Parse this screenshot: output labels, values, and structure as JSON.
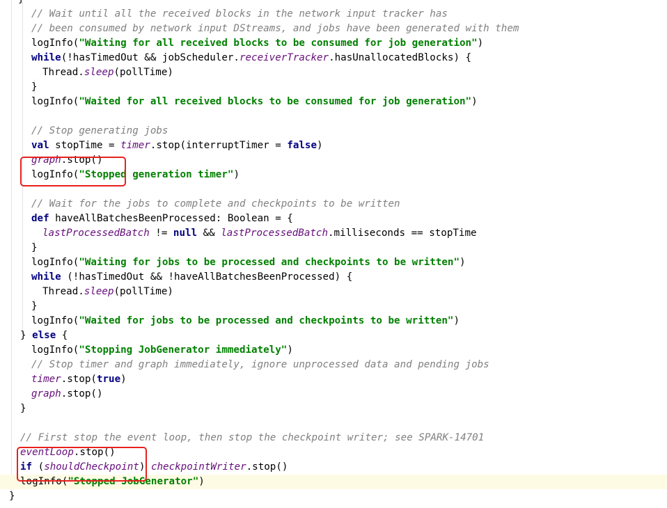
{
  "lines": [
    {
      "tokens": [
        {
          "t": "}",
          "c": "plain"
        }
      ]
    },
    {
      "tokens": [
        {
          "t": "// Wait until all the received blocks in the network input tracker has",
          "c": "comment"
        }
      ]
    },
    {
      "tokens": [
        {
          "t": "// been consumed by network input DStreams, and jobs have been generated with them",
          "c": "comment"
        }
      ]
    },
    {
      "tokens": [
        {
          "t": "logInfo(",
          "c": "plain"
        },
        {
          "t": "\"Waiting for all received blocks to be consumed for job generation\"",
          "c": "string"
        },
        {
          "t": ")",
          "c": "plain"
        }
      ]
    },
    {
      "tokens": [
        {
          "t": "while",
          "c": "keyword"
        },
        {
          "t": "(!hasTimedOut && jobScheduler.",
          "c": "plain"
        },
        {
          "t": "receiverTracker",
          "c": "field"
        },
        {
          "t": ".hasUnallocatedBlocks) {",
          "c": "plain"
        }
      ]
    },
    {
      "tokens": [
        {
          "t": "Thread.",
          "c": "plain"
        },
        {
          "t": "sleep",
          "c": "field"
        },
        {
          "t": "(pollTime)",
          "c": "plain"
        }
      ]
    },
    {
      "tokens": [
        {
          "t": "}",
          "c": "plain"
        }
      ]
    },
    {
      "tokens": [
        {
          "t": "logInfo(",
          "c": "plain"
        },
        {
          "t": "\"Waited for all received blocks to be consumed for job generation\"",
          "c": "string"
        },
        {
          "t": ")",
          "c": "plain"
        }
      ]
    },
    {
      "tokens": []
    },
    {
      "tokens": [
        {
          "t": "// Stop generating jobs",
          "c": "comment"
        }
      ]
    },
    {
      "tokens": [
        {
          "t": "val",
          "c": "keyword"
        },
        {
          "t": " stopTime = ",
          "c": "plain"
        },
        {
          "t": "timer",
          "c": "field"
        },
        {
          "t": ".stop(interruptTimer = ",
          "c": "plain"
        },
        {
          "t": "false",
          "c": "keyword"
        },
        {
          "t": ")",
          "c": "plain"
        }
      ]
    },
    {
      "tokens": [
        {
          "t": "graph",
          "c": "field"
        },
        {
          "t": ".stop()",
          "c": "plain"
        }
      ]
    },
    {
      "tokens": [
        {
          "t": "logInfo(",
          "c": "plain"
        },
        {
          "t": "\"Stopped generation timer\"",
          "c": "string"
        },
        {
          "t": ")",
          "c": "plain"
        }
      ]
    },
    {
      "tokens": []
    },
    {
      "tokens": [
        {
          "t": "// Wait for the jobs to complete and checkpoints to be written",
          "c": "comment"
        }
      ]
    },
    {
      "tokens": [
        {
          "t": "def",
          "c": "keyword"
        },
        {
          "t": " haveAllBatchesBeenProcessed: Boolean = {",
          "c": "plain"
        }
      ]
    },
    {
      "tokens": [
        {
          "t": "lastProcessedBatch",
          "c": "field"
        },
        {
          "t": " != ",
          "c": "plain"
        },
        {
          "t": "null",
          "c": "keyword"
        },
        {
          "t": " && ",
          "c": "plain"
        },
        {
          "t": "lastProcessedBatch",
          "c": "field"
        },
        {
          "t": ".milliseconds == stopTime",
          "c": "plain"
        }
      ]
    },
    {
      "tokens": [
        {
          "t": "}",
          "c": "plain"
        }
      ]
    },
    {
      "tokens": [
        {
          "t": "logInfo(",
          "c": "plain"
        },
        {
          "t": "\"Waiting for jobs to be processed and checkpoints to be written\"",
          "c": "string"
        },
        {
          "t": ")",
          "c": "plain"
        }
      ]
    },
    {
      "tokens": [
        {
          "t": "while",
          "c": "keyword"
        },
        {
          "t": " (!hasTimedOut && !haveAllBatchesBeenProcessed) {",
          "c": "plain"
        }
      ]
    },
    {
      "tokens": [
        {
          "t": "Thread.",
          "c": "plain"
        },
        {
          "t": "sleep",
          "c": "field"
        },
        {
          "t": "(pollTime)",
          "c": "plain"
        }
      ]
    },
    {
      "tokens": [
        {
          "t": "}",
          "c": "plain"
        }
      ]
    },
    {
      "tokens": [
        {
          "t": "logInfo(",
          "c": "plain"
        },
        {
          "t": "\"Waited for jobs to be processed and checkpoints to be written\"",
          "c": "string"
        },
        {
          "t": ")",
          "c": "plain"
        }
      ]
    },
    {
      "tokens": [
        {
          "t": "} ",
          "c": "plain"
        },
        {
          "t": "else",
          "c": "keyword"
        },
        {
          "t": " {",
          "c": "plain"
        }
      ]
    },
    {
      "tokens": [
        {
          "t": "logInfo(",
          "c": "plain"
        },
        {
          "t": "\"Stopping JobGenerator immediately\"",
          "c": "string"
        },
        {
          "t": ")",
          "c": "plain"
        }
      ]
    },
    {
      "tokens": [
        {
          "t": "// Stop timer and graph immediately, ignore unprocessed data and pending jobs",
          "c": "comment"
        }
      ]
    },
    {
      "tokens": [
        {
          "t": "timer",
          "c": "field"
        },
        {
          "t": ".stop(",
          "c": "plain"
        },
        {
          "t": "true",
          "c": "keyword"
        },
        {
          "t": ")",
          "c": "plain"
        }
      ]
    },
    {
      "tokens": [
        {
          "t": "graph",
          "c": "field"
        },
        {
          "t": ".stop()",
          "c": "plain"
        }
      ]
    },
    {
      "tokens": [
        {
          "t": "}",
          "c": "plain"
        }
      ]
    },
    {
      "tokens": []
    },
    {
      "tokens": [
        {
          "t": "// First stop the event loop, then stop the checkpoint writer; see SPARK-14701",
          "c": "comment"
        }
      ]
    },
    {
      "tokens": [
        {
          "t": "eventLoop",
          "c": "field"
        },
        {
          "t": ".stop()",
          "c": "plain"
        }
      ]
    },
    {
      "tokens": [
        {
          "t": "if",
          "c": "keyword"
        },
        {
          "t": " (",
          "c": "plain"
        },
        {
          "t": "shouldCheckpoint",
          "c": "field"
        },
        {
          "t": ") ",
          "c": "plain"
        },
        {
          "t": "checkpointWriter",
          "c": "field"
        },
        {
          "t": ".stop()",
          "c": "plain"
        }
      ]
    },
    {
      "tokens": [
        {
          "t": "logInfo(",
          "c": "plain"
        },
        {
          "t": "\"Stopped JobGenerator\"",
          "c": "string"
        },
        {
          "t": ")",
          "c": "plain"
        }
      ]
    },
    {
      "tokens": [
        {
          "t": "}",
          "c": "plain"
        }
      ]
    }
  ],
  "colors": {
    "comment": "#808080",
    "string": "#008000",
    "keyword": "#000080",
    "field": "#660e7a",
    "annotation_box": "#e8211d",
    "current_line": "#fefbe5"
  }
}
